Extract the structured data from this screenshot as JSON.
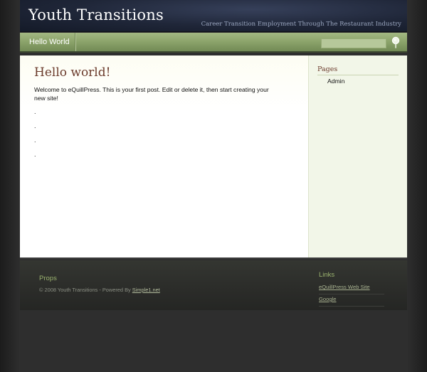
{
  "header": {
    "site_title": "Youth Transitions",
    "tagline": "Career Transition Employment Through The Restaurant Industry"
  },
  "nav": {
    "items": [
      {
        "label": "Hello World"
      }
    ],
    "search_placeholder": "",
    "search_icon": "magnifier-icon"
  },
  "post": {
    "title": "Hello world!",
    "body": "Welcome to eQuillPress. This is your first post. Edit or delete it, then start creating your new site!",
    "dots": [
      ".",
      ".",
      ".",
      "."
    ]
  },
  "sidebar": {
    "heading": "Pages",
    "links": [
      {
        "label": "Admin"
      }
    ]
  },
  "footer": {
    "props_heading": "Props",
    "copyright_prefix": "© 2008 Youth Transitions - Powered By ",
    "powered_by_link": "Simple1.net",
    "links_heading": "Links",
    "links": [
      {
        "label": "eQuillPress Web Site"
      },
      {
        "label": "Google"
      }
    ]
  },
  "colors": {
    "header_bg": "#1f2638",
    "nav_green": "#8ba36a",
    "title_brown": "#6b3b2c",
    "sidebar_bg": "#f2f6e8",
    "footer_heading_green": "#9bb36f",
    "page_bg": "#2e2e2e"
  }
}
